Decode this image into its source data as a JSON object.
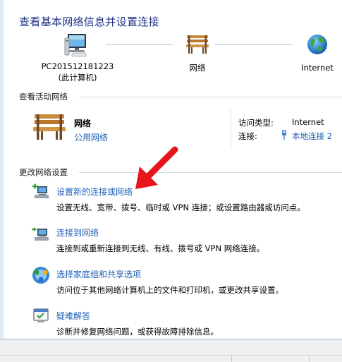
{
  "header": {
    "title": "查看基本网络信息并设置连接"
  },
  "map": {
    "computer": {
      "name": "PC201512181223",
      "sub": "(此计算机)",
      "icon": "computer-icon"
    },
    "network": {
      "name": "网络",
      "icon": "bench-icon"
    },
    "internet": {
      "name": "Internet",
      "icon": "globe-icon"
    }
  },
  "active_networks": {
    "header": "查看活动网络",
    "name": "网络",
    "type": "公用网络",
    "access_type_label": "访问类型:",
    "access_type_value": "Internet",
    "connection_label": "连接:",
    "connection_value": "本地连接 2"
  },
  "change_settings": {
    "header": "更改网络设置",
    "tasks": [
      {
        "title": "设置新的连接或网络",
        "desc": "设置无线、宽带、拨号、临时或 VPN 连接；或设置路由器或访问点。",
        "icon": "new-connection-icon"
      },
      {
        "title": "连接到网络",
        "desc": "连接到或重新连接到无线、有线、拨号或 VPN 网络连接。",
        "icon": "connect-network-icon"
      },
      {
        "title": "选择家庭组和共享选项",
        "desc": "访问位于其他网络计算机上的文件和打印机，或更改共享设置。",
        "icon": "homegroup-icon"
      },
      {
        "title": "疑难解答",
        "desc": "诊断并修复网络问题，或获得故障排除信息。",
        "icon": "troubleshoot-icon"
      }
    ]
  },
  "annotation": {
    "color": "#e8141b"
  }
}
